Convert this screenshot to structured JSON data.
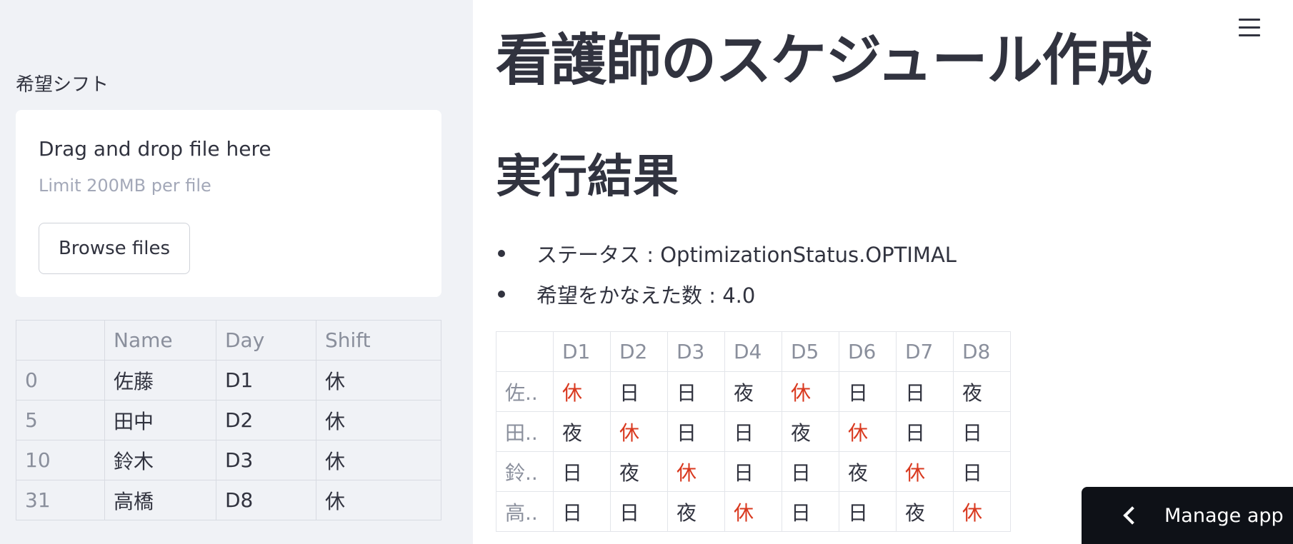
{
  "sidebar": {
    "uploader_label": "希望シフト",
    "dropzone": {
      "title": "Drag and drop file here",
      "limit": "Limit 200MB per file",
      "browse_label": "Browse files"
    },
    "table": {
      "headers": [
        "",
        "Name",
        "Day",
        "Shift"
      ],
      "rows": [
        [
          "0",
          "佐藤",
          "D1",
          "休"
        ],
        [
          "5",
          "田中",
          "D2",
          "休"
        ],
        [
          "10",
          "鈴木",
          "D3",
          "休"
        ],
        [
          "31",
          "高橋",
          "D8",
          "休"
        ]
      ]
    }
  },
  "main": {
    "title": "看護師のスケジュール作成",
    "subtitle": "実行結果",
    "bullets": [
      "ステータス : OptimizationStatus.OPTIMAL",
      "希望をかなえた数 : 4.0"
    ],
    "result_table": {
      "headers": [
        "",
        "D1",
        "D2",
        "D3",
        "D4",
        "D5",
        "D6",
        "D7",
        "D8"
      ],
      "rows": [
        {
          "name": "佐..",
          "cells": [
            "休",
            "日",
            "日",
            "夜",
            "休",
            "日",
            "日",
            "夜"
          ]
        },
        {
          "name": "田..",
          "cells": [
            "夜",
            "休",
            "日",
            "日",
            "夜",
            "休",
            "日",
            "日"
          ]
        },
        {
          "name": "鈴..",
          "cells": [
            "日",
            "夜",
            "休",
            "日",
            "日",
            "夜",
            "休",
            "日"
          ]
        },
        {
          "name": "高..",
          "cells": [
            "日",
            "日",
            "夜",
            "休",
            "日",
            "日",
            "夜",
            "休"
          ]
        }
      ],
      "highlight_value": "休",
      "highlight_color": "#d9391f"
    }
  },
  "manage_app": {
    "label": "Manage app",
    "icon": "chevron-left-icon"
  },
  "colors": {
    "sidebar_bg": "#f0f2f6",
    "text": "#31333f",
    "muted": "#8a8f9c",
    "manage_bg": "#0e1117"
  }
}
